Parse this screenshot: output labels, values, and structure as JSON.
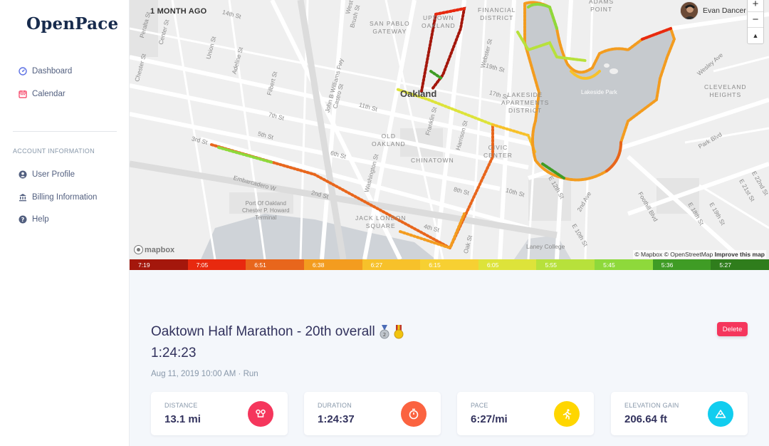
{
  "brand": "OpenPace",
  "nav": [
    {
      "label": "Dashboard",
      "icon": "dashboard-icon",
      "color": "#5e72e4"
    },
    {
      "label": "Calendar",
      "icon": "calendar-icon",
      "color": "#f5365c"
    }
  ],
  "account_section": {
    "title": "ACCOUNT INFORMATION",
    "items": [
      {
        "label": "User Profile",
        "icon": "user-icon"
      },
      {
        "label": "Billing Information",
        "icon": "bank-icon"
      },
      {
        "label": "Help",
        "icon": "help-icon"
      }
    ]
  },
  "map": {
    "time_ago": "1 MONTH AGO",
    "user_name": "Evan Dancer",
    "zoom_in": "+",
    "zoom_out": "−",
    "compass": "▲",
    "logo_text": "mapbox",
    "attribution_1": "© Mapbox © OpenStreetMap",
    "attribution_2": "Improve this map",
    "labels": {
      "peralta": "Peralta St",
      "center": "Center St",
      "union": "Union St",
      "adeline": "Adeline St",
      "chester": "Chester St",
      "filbert": "Filbert St",
      "jbwilliams": "John B Williams Fwy",
      "castro": "Castro St",
      "brush": "Brush St",
      "west": "West St",
      "fourteenth": "14th St",
      "seventh": "7th St",
      "fifth": "5th St",
      "third": "3rd St",
      "sixth": "6th St",
      "eleventh": "11th St",
      "embarcadero": "Embarcadero W",
      "secondst": "2nd St",
      "washington": "Washington St",
      "fourth": "4th St",
      "eighth": "8th St",
      "tenth": "10th St",
      "oak": "Oak St",
      "franklin": "Franklin St",
      "harrison": "Harrison St",
      "webster": "Webster St",
      "nineteenth": "19th St",
      "seventeenth": "17th St",
      "sanpablo_1": "SAN PABLO",
      "sanpablo_2": "GATEWAY",
      "uptown_1": "UPTOWN",
      "uptown_2": "OAKLAND",
      "financial_1": "FINANCIAL",
      "financial_2": "DISTRICT",
      "adams_1": "ADAMS",
      "adams_2": "POINT",
      "oakland": "Oakland",
      "oldoakland_1": "OLD",
      "oldoakland_2": "OAKLAND",
      "chinatown": "CHINATOWN",
      "civic_1": "CIVIC",
      "civic_2": "CENTER",
      "lakeside_1": "LAKESIDE",
      "lakeside_2": "APARTMENTS",
      "lakeside_3": "DISTRICT",
      "lakesidepark": "Lakeside Park",
      "cleveland_1": "CLEVELAND",
      "cleveland_2": "HEIGHTS",
      "parkblvd": "Park Blvd",
      "wesley": "Wesley Ave",
      "foothill": "Foothill Blvd",
      "e18": "E 18th St",
      "e19": "E 19th St",
      "e21": "E 21st St",
      "e22": "E 22nd St",
      "second_ave": "2nd Ave",
      "e10": "E 10th St",
      "e12": "E 12th St",
      "laney": "Laney College",
      "port_1": "Port Of Oakland",
      "port_2": "Chester P. Howard",
      "port_3": "Terminal",
      "jacklondon_1": "JACK LONDON",
      "jacklondon_2": "SQUARE"
    }
  },
  "pace_legend": [
    {
      "label": "7:19",
      "color": "#a4170c"
    },
    {
      "label": "7:05",
      "color": "#e8290f"
    },
    {
      "label": "6:51",
      "color": "#e8661c"
    },
    {
      "label": "6:38",
      "color": "#f39c1f"
    },
    {
      "label": "6:27",
      "color": "#f7c12a"
    },
    {
      "label": "6:15",
      "color": "#f7d032"
    },
    {
      "label": "6:05",
      "color": "#dde33a"
    },
    {
      "label": "5:55",
      "color": "#b7e13b"
    },
    {
      "label": "5:45",
      "color": "#8ed93b"
    },
    {
      "label": "5:36",
      "color": "#3f9c25"
    },
    {
      "label": "5:27",
      "color": "#2f7d1c"
    }
  ],
  "activity": {
    "title": "Oaktown Half Marathon - 20th overall",
    "time": "1:24:23",
    "meta": "Aug 11, 2019 10:00 AM · Run",
    "delete_label": "Delete",
    "medals": [
      "second-place-medal-icon",
      "military-medal-icon"
    ]
  },
  "stats": [
    {
      "label": "DISTANCE",
      "value": "13.1 mi",
      "icon": "route-icon",
      "color": "#f5365c"
    },
    {
      "label": "DURATION",
      "value": "1:24:37",
      "icon": "stopwatch-icon",
      "color": "#fb6340"
    },
    {
      "label": "PACE",
      "value": "6:27/mi",
      "icon": "runner-icon",
      "color": "#ffd600"
    },
    {
      "label": "ELEVATION GAIN",
      "value": "206.64 ft",
      "icon": "mountain-icon",
      "color": "#11cdef"
    }
  ]
}
